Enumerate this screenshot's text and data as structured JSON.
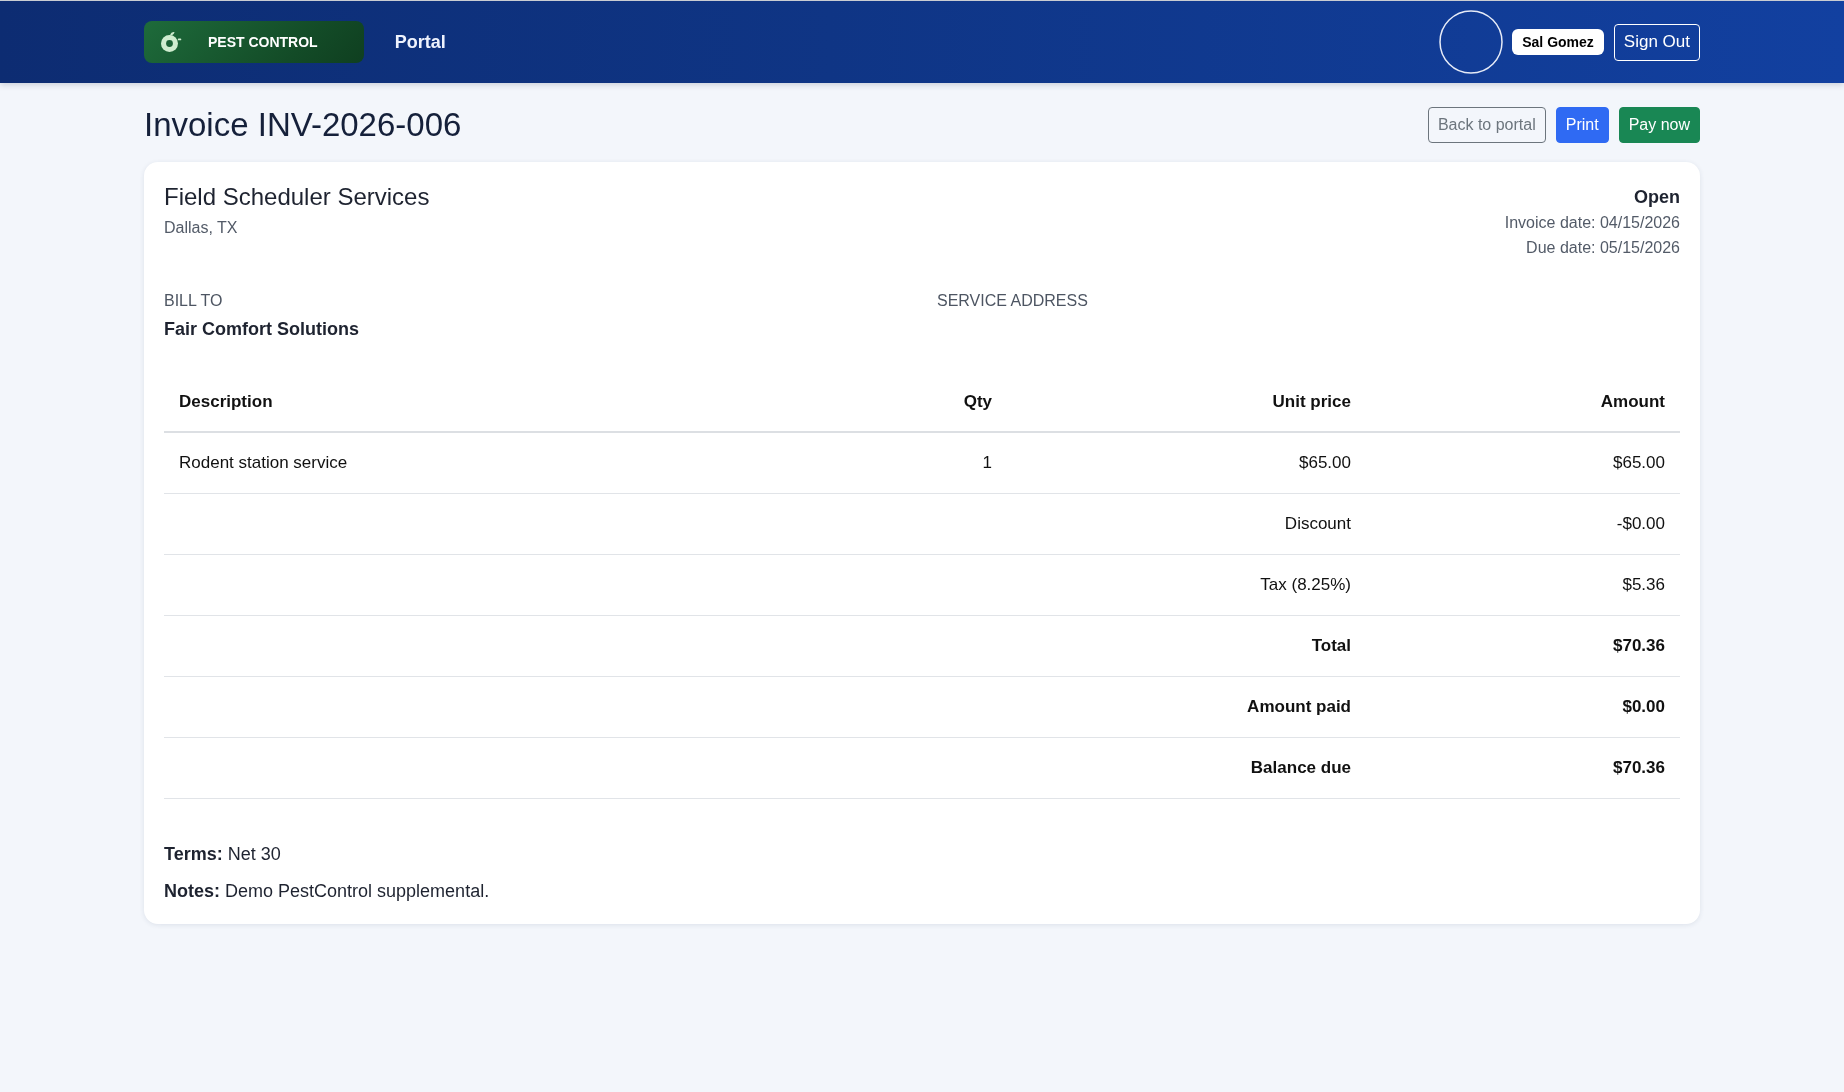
{
  "header": {
    "brand": {
      "label": "PEST CONTROL"
    },
    "nav_link": "Portal",
    "user": {
      "name": "Sal Gomez"
    },
    "sign_out": "Sign Out"
  },
  "page": {
    "title": "Invoice INV-2026-006",
    "actions": [
      {
        "label": "Back to portal",
        "kind": "outline"
      },
      {
        "label": "Print",
        "kind": "primary"
      },
      {
        "label": "Pay now",
        "kind": "success"
      }
    ]
  },
  "invoice": {
    "company": {
      "name": "Field Scheduler Services",
      "location": "Dallas, TX"
    },
    "status": "Open",
    "invoice_date": "Invoice date: 04/15/2026",
    "due_date": "Due date: 05/15/2026",
    "bill_to": {
      "label": "BILL TO",
      "name": "Fair Comfort Solutions"
    },
    "service_address": {
      "label": "SERVICE ADDRESS"
    },
    "table": {
      "columns": [
        "Description",
        "Qty",
        "Unit price",
        "Amount"
      ],
      "rows": [
        {
          "description": "Rodent station service",
          "qty": "1",
          "unit_price": "$65.00",
          "amount": "$65.00"
        }
      ],
      "summary": [
        {
          "label": "Discount",
          "value": "-$0.00",
          "kind": "line"
        },
        {
          "label": "Tax (8.25%)",
          "value": "$5.36",
          "kind": "line"
        },
        {
          "label": "Total",
          "value": "$70.36",
          "kind": "total"
        },
        {
          "label": "Amount paid",
          "value": "$0.00",
          "kind": "total"
        },
        {
          "label": "Balance due",
          "value": "$70.36",
          "kind": "total"
        }
      ]
    },
    "terms": "**Terms:** Net 30",
    "notes": "**Notes:** Demo PestControl supplemental."
  }
}
